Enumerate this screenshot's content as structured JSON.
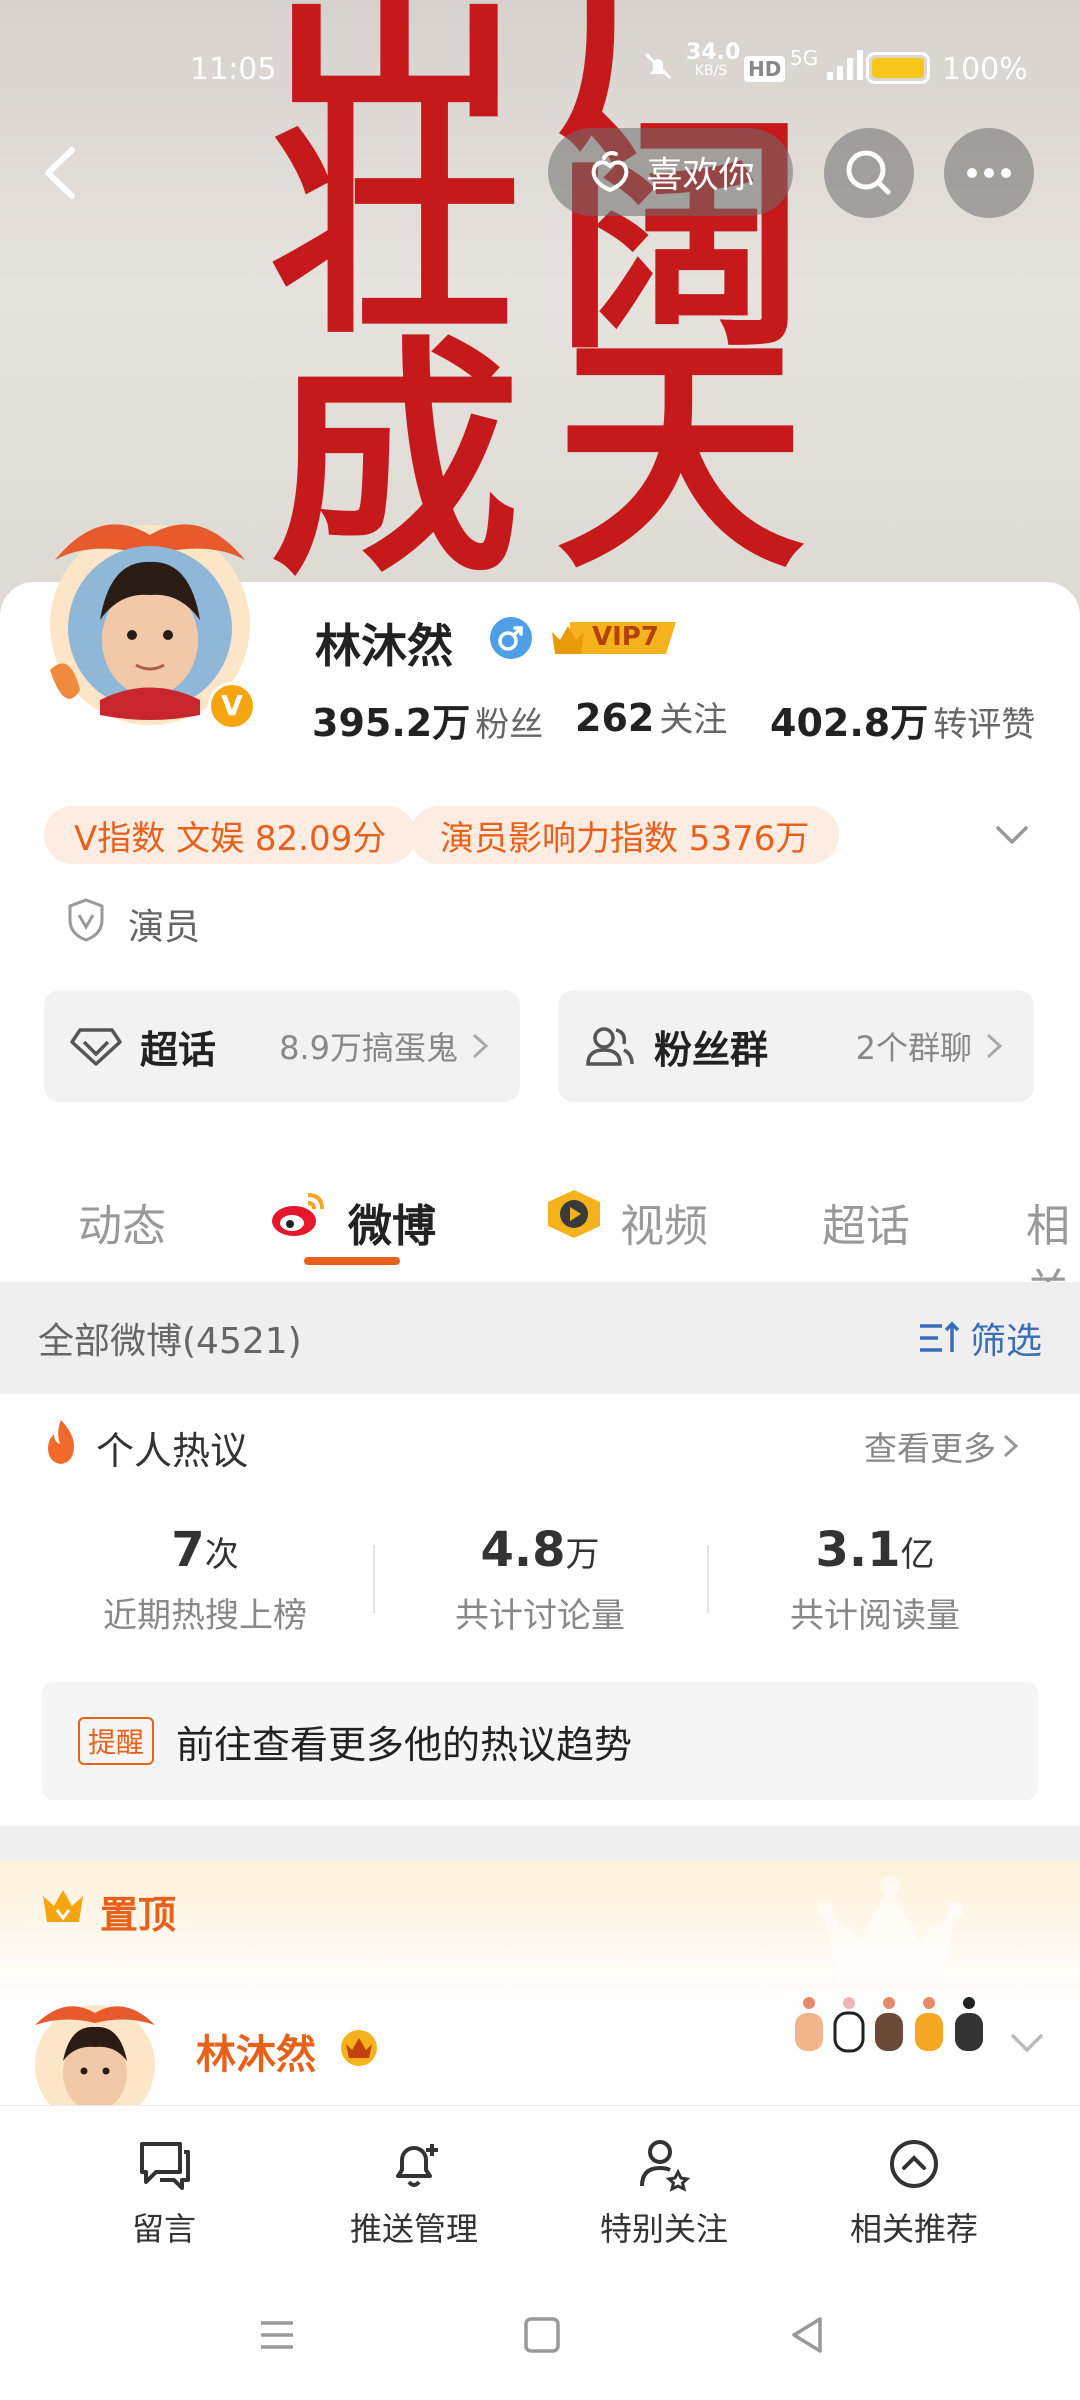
{
  "status_bar": {
    "time": "11:05",
    "net_speed": "34.0",
    "net_unit": "KB/S",
    "hd": "HD",
    "signal": "5G",
    "battery": "100%"
  },
  "banner": {
    "wall_chars": [
      "壮",
      "成",
      "广",
      "阔",
      "天"
    ],
    "like_label": "喜欢你"
  },
  "profile": {
    "name": "林沐然",
    "vip": "VIP7",
    "followers_num": "395.2万",
    "followers_lbl": "粉丝",
    "following_num": "262",
    "following_lbl": "关注",
    "likes_num": "402.8万",
    "likes_lbl": "转评赞",
    "tag1": "V指数 文娱 82.09分",
    "tag2": "演员影响力指数 5376万",
    "role": "演员"
  },
  "groups": {
    "supertopic": {
      "title": "超话",
      "sub": "8.9万搞蛋鬼"
    },
    "fans": {
      "title": "粉丝群",
      "sub": "2个群聊"
    }
  },
  "tabs": [
    "动态",
    "微博",
    "视频",
    "超话",
    "相关"
  ],
  "filter": {
    "label": "全部微博(4521)",
    "action": "筛选"
  },
  "hot": {
    "title": "个人热议",
    "more": "查看更多",
    "kpis": [
      {
        "num": "7",
        "unit": "次",
        "label": "近期热搜上榜"
      },
      {
        "num": "4.8",
        "unit": "万",
        "label": "共计讨论量"
      },
      {
        "num": "3.1",
        "unit": "亿",
        "label": "共计阅读量"
      }
    ],
    "reminder_tag": "提醒",
    "reminder_text": "前往查看更多他的热议趋势"
  },
  "pinned": {
    "label": "置顶",
    "name": "林沐然"
  },
  "bottom_bar": [
    {
      "label": "留言",
      "icon": "message-icon"
    },
    {
      "label": "推送管理",
      "icon": "bell-icon"
    },
    {
      "label": "特别关注",
      "icon": "user-star-icon"
    },
    {
      "label": "相关推荐",
      "icon": "chevron-up-circle-icon"
    }
  ],
  "colors": {
    "accent": "#e8611a",
    "vip_gold": "#f5b21d",
    "verified_blue": "#4f9ee8"
  }
}
